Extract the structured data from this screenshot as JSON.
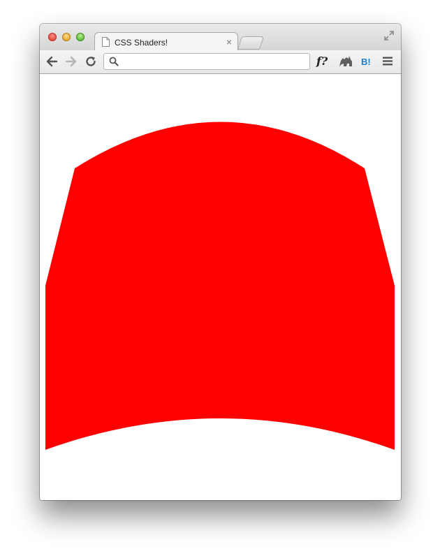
{
  "browser": {
    "tab": {
      "title": "CSS Shaders!"
    },
    "omnibox": {
      "value": "",
      "placeholder": ""
    },
    "extensions": {
      "fquestion_label": "f?",
      "hatena_label": "B!"
    }
  },
  "content": {
    "shape_color": "#ff0000"
  }
}
